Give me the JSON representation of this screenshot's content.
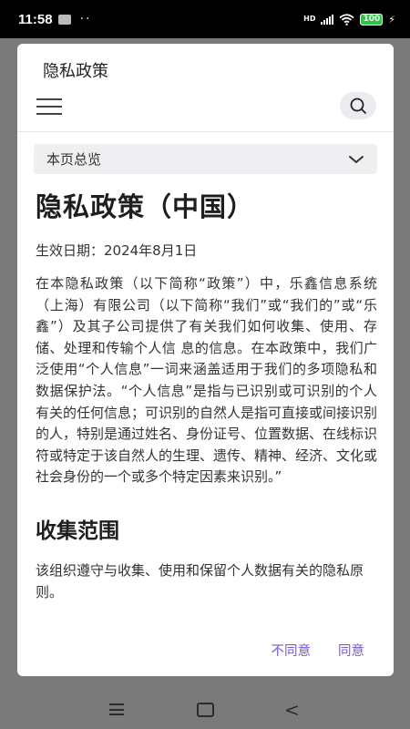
{
  "status_bar": {
    "time": "11:58",
    "dots": "··",
    "network": "HD",
    "battery": "100"
  },
  "dialog": {
    "title": "隐私政策",
    "overview_label": "本页总览",
    "heading": "隐私政策（中国）",
    "effective_date": "生效日期：2024年8月1日",
    "intro": "在本隐私政策（以下简称“政策”）中，乐鑫信息系统（上海）有限公司（以下简称“我们”或“我们的”或“乐鑫”）及其子公司提供了有关我们如何收集、使用、存储、处理和传输个人信 息的信息。在本政策中，我们广泛使用“个人信息”一词来涵盖适用于我们的多项隐私和数据保护法。“个人信息”是指与已识别或可识别的个人有关的任何信息；可识别的自然人是指可直接或间接识别的人，特别是通过姓名、身份证号、位置数据、在线标识符或特定于该自然人的生理、遗传、精神、经济、文化或社会身份的一个或多个特定因素来识别。”",
    "section_heading": "收集范围",
    "section_text": "该组织遵守与收集、使用和保留个人数据有关的隐私原则。",
    "disagree_label": "不同意",
    "agree_label": "同意"
  },
  "colors": {
    "accent": "#7b55d6",
    "overview_bg": "#efeff1",
    "scrim": "#7a7a7a"
  },
  "icons": [
    "menu-icon",
    "search-icon",
    "chevron-down-icon",
    "wifi-icon",
    "signal-icon",
    "battery-icon",
    "nav-menu-icon",
    "nav-home-icon",
    "nav-back-icon"
  ]
}
